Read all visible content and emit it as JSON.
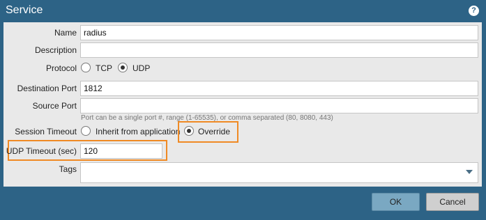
{
  "dialog": {
    "title": "Service",
    "help_icon": "?"
  },
  "form": {
    "name_label": "Name",
    "name_value": "radius",
    "description_label": "Description",
    "description_value": "",
    "protocol_label": "Protocol",
    "protocol_options": [
      "TCP",
      "UDP"
    ],
    "protocol_selected": "UDP",
    "destination_port_label": "Destination Port",
    "destination_port_value": "1812",
    "source_port_label": "Source Port",
    "source_port_value": "",
    "port_hint": "Port can be a single port #, range (1-65535), or comma separated (80, 8080, 443)",
    "session_timeout_label": "Session Timeout",
    "session_timeout_options": [
      "Inherit from application",
      "Override"
    ],
    "session_timeout_selected": "Override",
    "udp_timeout_label": "UDP Timeout (sec)",
    "udp_timeout_value": "120",
    "tags_label": "Tags",
    "tags_value": ""
  },
  "buttons": {
    "ok": "OK",
    "cancel": "Cancel"
  },
  "colors": {
    "title_bar": "#2d6386",
    "highlight": "#f08a24",
    "ok_button": "#7aa8c2"
  }
}
